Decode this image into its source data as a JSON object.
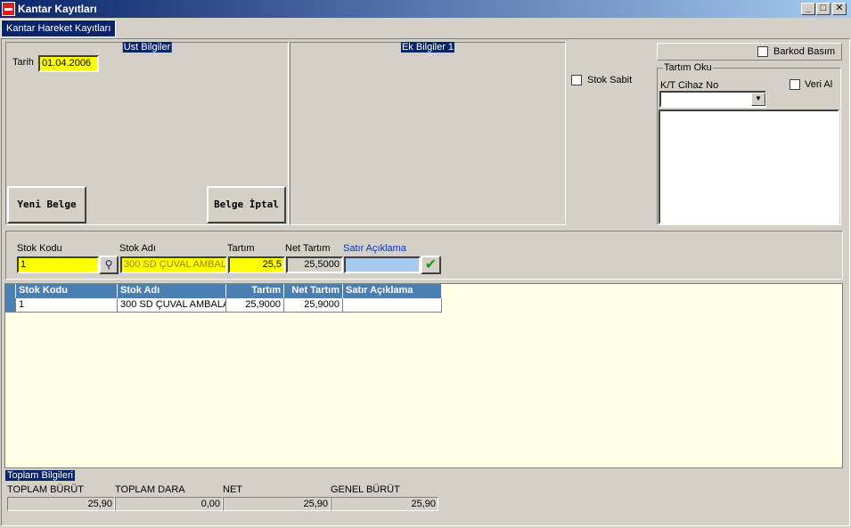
{
  "window": {
    "title": "Kantar Kayıtları",
    "min": "_",
    "max": "□",
    "close": "✕"
  },
  "tabs": {
    "active": "Kantar Hareket Kayıtları"
  },
  "ust_bilgiler": {
    "caption": "Ust Bilgiler",
    "tarih_label": "Tarih",
    "tarih_value": "01.04.2006",
    "yeni_belge": "Yeni Belge",
    "belge_iptal": "Belge İptal"
  },
  "ek_bilgiler": {
    "caption": "Ek Bilgiler 1"
  },
  "stok_sabit": {
    "label": "Stok Sabit"
  },
  "barkod": {
    "label": "Barkod Basım"
  },
  "tartim_oku": {
    "caption": "Tartım Oku",
    "cihaz_label": "K/T Cihaz No",
    "veri_al": "Veri Al",
    "cihaz_value": ""
  },
  "entry": {
    "stok_kodu_label": "Stok Kodu",
    "stok_adi_label": "Stok Adı",
    "tartim_label": "Tartım",
    "net_tartim_label": "Net Tartım",
    "satir_aciklama_label": "Satır Açıklama",
    "stok_kodu": "1",
    "stok_adi": "300 SD ÇUVAL AMBAL",
    "tartim": "25,5",
    "net_tartim": "25,5000",
    "satir_aciklama": ""
  },
  "grid": {
    "columns": [
      "Stok Kodu",
      "Stok Adı",
      "Tartım",
      "Net Tartım",
      "Satır Açıklama"
    ],
    "rows": [
      {
        "stok_kodu": "1",
        "stok_adi": "300 SD ÇUVAL AMBALA",
        "tartim": "25,9000",
        "net_tartim": "25,9000",
        "satir_aciklama": ""
      }
    ]
  },
  "toplam": {
    "caption": "Toplam Bilgileri",
    "labels": [
      "TOPLAM BÜRÜT",
      "TOPLAM DARA",
      "NET",
      "GENEL BÜRÜT"
    ],
    "values": [
      "25,90",
      "0,00",
      "25,90",
      "25,90"
    ]
  }
}
